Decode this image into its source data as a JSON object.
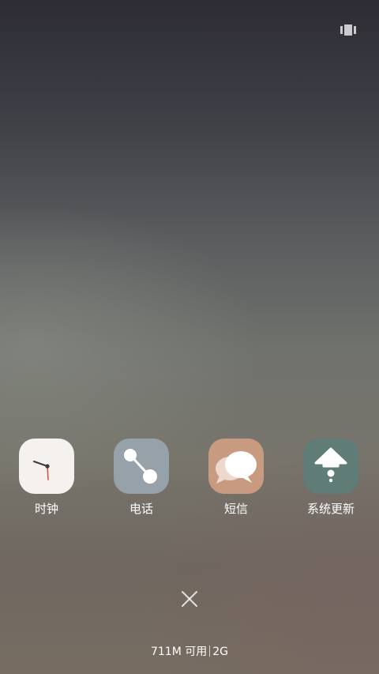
{
  "recents": {
    "apps": [
      {
        "label": "时钟",
        "icon": "clock-icon",
        "color": "#f4f1ef"
      },
      {
        "label": "电话",
        "icon": "phone-icon",
        "color": "#97a1aa"
      },
      {
        "label": "短信",
        "icon": "message-bubbles-icon",
        "color": "#c89a7f"
      },
      {
        "label": "系统更新",
        "icon": "system-update-icon",
        "color": "#5f7c77"
      }
    ]
  },
  "memory": {
    "available": "711M 可用",
    "total": "2G"
  }
}
